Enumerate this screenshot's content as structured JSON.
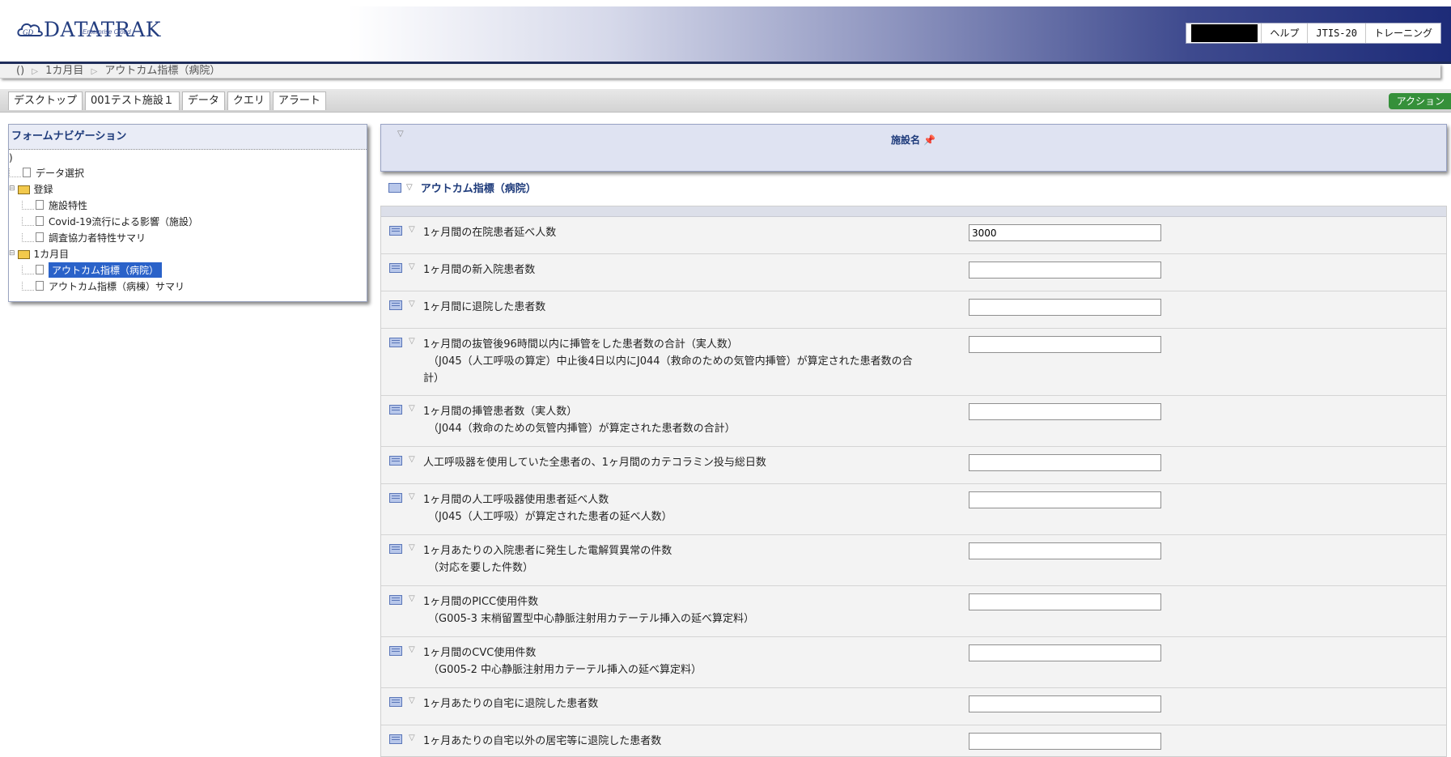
{
  "header": {
    "logo_text": "DATATRAK",
    "logo_sub": "Enterprise Cloud",
    "links": [
      "ヘルプ",
      "JTIS-20",
      "トレーニング"
    ]
  },
  "breadcrumb": [
    "()",
    "1カ月目",
    "アウトカム指標（病院）"
  ],
  "tabs": [
    "デスクトップ",
    "001テスト施設１",
    "データ",
    "クエリ",
    "アラート"
  ],
  "action_label": "アクション",
  "nav": {
    "title": "フォームナビゲーション",
    "root": ")",
    "items": [
      "データ選択",
      "登録",
      "施設特性",
      "Covid-19流行による影響（施設）",
      "調査協力者特性サマリ",
      "1カ月目",
      "アウトカム指標（病院）",
      "アウトカム指標（病棟）サマリ"
    ]
  },
  "form": {
    "facility_label": "施設名",
    "section_title": "アウトカム指標（病院）",
    "questions": [
      {
        "text": "1ヶ月間の在院患者延べ人数",
        "sub": "",
        "sub2": "",
        "value": "3000"
      },
      {
        "text": "1ヶ月間の新入院患者数",
        "sub": "",
        "sub2": "",
        "value": ""
      },
      {
        "text": "1ヶ月間に退院した患者数",
        "sub": "",
        "sub2": "",
        "value": ""
      },
      {
        "text": "1ヶ月間の抜管後96時間以内に挿管をした患者数の合計（実人数）",
        "sub": "（J045（人工呼吸の算定）中止後4日以内にJ044（救命のための気管内挿管）が算定された患者数の合",
        "sub2": "計）",
        "value": ""
      },
      {
        "text": "1ヶ月間の挿管患者数（実人数）",
        "sub": "（J044（救命のための気管内挿管）が算定された患者数の合計）",
        "sub2": "",
        "value": ""
      },
      {
        "text": "人工呼吸器を使用していた全患者の、1ヶ月間のカテコラミン投与総日数",
        "sub": "",
        "sub2": "",
        "value": ""
      },
      {
        "text": "1ヶ月間の人工呼吸器使用患者延べ人数",
        "sub": "（J045（人工呼吸）が算定された患者の延べ人数）",
        "sub2": "",
        "value": ""
      },
      {
        "text": "1ヶ月あたりの入院患者に発生した電解質異常の件数",
        "sub": "（対応を要した件数）",
        "sub2": "",
        "value": ""
      },
      {
        "text": "1ヶ月間のPICC使用件数",
        "sub": "（G005-3 末梢留置型中心静脈注射用カテーテル挿入の延べ算定料）",
        "sub2": "",
        "value": ""
      },
      {
        "text": "1ヶ月間のCVC使用件数",
        "sub": "（G005-2 中心静脈注射用カテーテル挿入の延べ算定料）",
        "sub2": "",
        "value": ""
      },
      {
        "text": "1ヶ月あたりの自宅に退院した患者数",
        "sub": "",
        "sub2": "",
        "value": ""
      },
      {
        "text": "1ヶ月あたりの自宅以外の居宅等に退院した患者数",
        "sub": "",
        "sub2": "",
        "value": ""
      }
    ]
  }
}
